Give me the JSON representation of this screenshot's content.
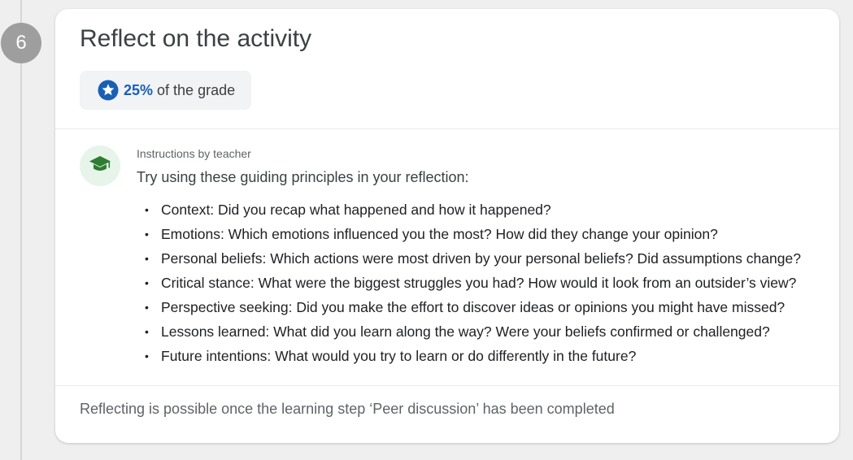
{
  "step": {
    "number": "6"
  },
  "card": {
    "title": "Reflect on the activity",
    "grade": {
      "percent": "25%",
      "suffix": "of the grade",
      "icon": "star-icon"
    },
    "instructions": {
      "label": "Instructions by teacher",
      "avatar_icon": "graduation-cap-icon",
      "intro": "Try using these guiding principles in your reflection:",
      "principles": [
        "Context: Did you recap what happened and how it happened?",
        "Emotions: Which emotions influenced you the most? How did they change your opinion?",
        "Personal beliefs: Which actions were most driven by your personal beliefs? Did assumptions change?",
        "Critical stance: What were the biggest struggles you had? How would it look from an outsider’s view?",
        "Perspective seeking: Did you make the effort to discover ideas or opinions you might have missed?",
        "Lessons learned: What did you learn along the way? Were your beliefs confirmed or challenged?",
        "Future intentions: What would you try to learn or do differently in the future?"
      ]
    },
    "footer_note": "Reflecting is possible once the learning step ‘Peer discussion’ has been completed"
  },
  "colors": {
    "accent_blue": "#1a5fb4",
    "teacher_green": "#2e7d32",
    "step_circle": "#9e9e9e"
  }
}
